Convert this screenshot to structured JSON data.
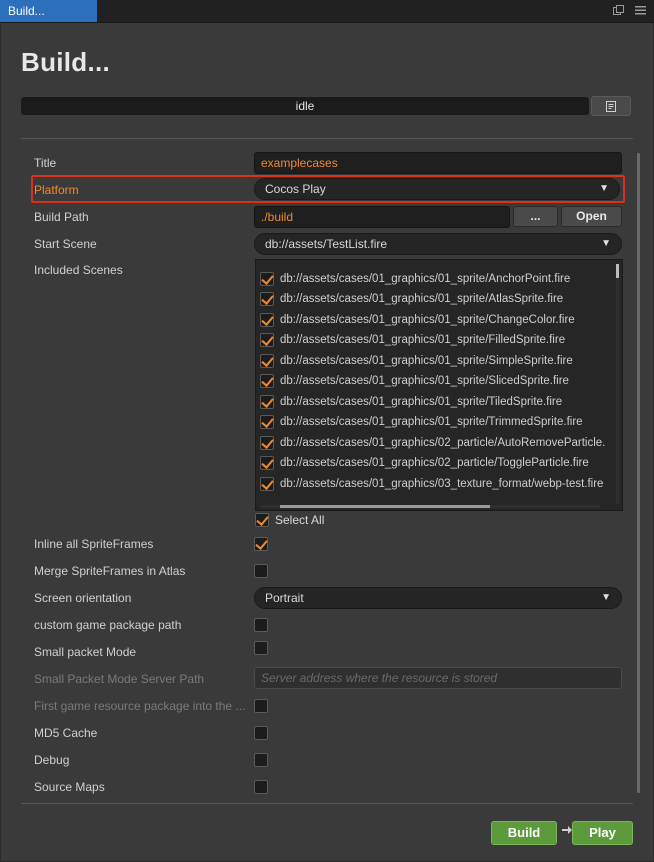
{
  "tab": {
    "label": "Build..."
  },
  "header": {
    "title": "Build...",
    "status": "idle"
  },
  "fields": {
    "title": {
      "label": "Title",
      "value": "examplecases"
    },
    "platform": {
      "label": "Platform",
      "value": "Cocos Play"
    },
    "build_path": {
      "label": "Build Path",
      "value": "./build",
      "browse_label": "...",
      "open_label": "Open"
    },
    "start_scene": {
      "label": "Start Scene",
      "value": "db://assets/TestList.fire"
    },
    "included_scenes": {
      "label": "Included Scenes",
      "items": [
        "db://assets/cases/01_graphics/01_sprite/AnchorPoint.fire",
        "db://assets/cases/01_graphics/01_sprite/AtlasSprite.fire",
        "db://assets/cases/01_graphics/01_sprite/ChangeColor.fire",
        "db://assets/cases/01_graphics/01_sprite/FilledSprite.fire",
        "db://assets/cases/01_graphics/01_sprite/SimpleSprite.fire",
        "db://assets/cases/01_graphics/01_sprite/SlicedSprite.fire",
        "db://assets/cases/01_graphics/01_sprite/TiledSprite.fire",
        "db://assets/cases/01_graphics/01_sprite/TrimmedSprite.fire",
        "db://assets/cases/01_graphics/02_particle/AutoRemoveParticle.",
        "db://assets/cases/01_graphics/02_particle/ToggleParticle.fire",
        "db://assets/cases/01_graphics/03_texture_format/webp-test.fire"
      ],
      "select_all_label": "Select All"
    },
    "inline_spriteframes": {
      "label": "Inline all SpriteFrames",
      "checked": true
    },
    "merge_spriteframes": {
      "label": "Merge SpriteFrames in Atlas",
      "checked": false
    },
    "screen_orientation": {
      "label": "Screen orientation",
      "value": "Portrait"
    },
    "custom_package_path": {
      "label": "custom game package path",
      "checked": false
    },
    "small_packet_mode": {
      "label": "Small packet Mode",
      "checked": false
    },
    "small_packet_server": {
      "label": "Small Packet Mode Server Path",
      "placeholder": "Server address where the resource is stored"
    },
    "first_game_resource": {
      "label": "First game resource package into the ...",
      "checked": false
    },
    "md5_cache": {
      "label": "MD5 Cache",
      "checked": false
    },
    "debug": {
      "label": "Debug",
      "checked": false
    },
    "source_maps": {
      "label": "Source Maps",
      "checked": false
    }
  },
  "footer": {
    "build_label": "Build",
    "play_label": "Play"
  },
  "colors": {
    "accent": "#f08a30",
    "highlight": "#d9301b",
    "green": "#5c9a3c",
    "tab_blue": "#2c6fbd"
  }
}
